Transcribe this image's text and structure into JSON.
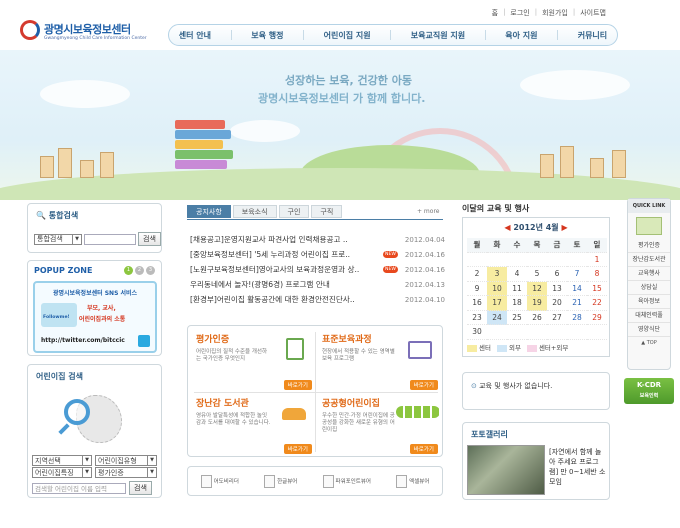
{
  "logo": {
    "ko": "광명시보육정보센터",
    "en": "Gwangmyeong Child Care Information Center"
  },
  "util": [
    "홈",
    "로그인",
    "회원가입",
    "사이트맵"
  ],
  "gnb": [
    "센터 안내",
    "보육 행정",
    "어린이집 지원",
    "보육교직원 지원",
    "육아 지원",
    "커뮤니티"
  ],
  "hero": {
    "line1": "성장하는 보육, 건강한 아동",
    "line2": "광명시보육정보센터 가 함께 합니다."
  },
  "search": {
    "title": "통합검색",
    "select": "통합검색",
    "button": "검색"
  },
  "popup": {
    "title": "POPUP ZONE",
    "pages": [
      "1",
      "2",
      "3"
    ],
    "sns_title": "광명시보육정보센터 SNS 서비스",
    "line1": "부모, 교사,",
    "line2": "어린이집과의 소통",
    "followme": "Followme!",
    "url": "http://twitter.com/bitccic"
  },
  "daycare": {
    "title": "어린이집 검색",
    "sel1": "지역선택",
    "sel2": "어린이집유형",
    "sel3": "어린이집특징",
    "sel4": "평가인증",
    "placeholder": "검색할 어린이집 이름 입력",
    "button": "검색"
  },
  "tabs": [
    "공지사항",
    "보육소식",
    "구인",
    "구직"
  ],
  "more": "+ more",
  "new_label": "NEW",
  "notices": [
    {
      "title": "[채용공고]운영지원교사 파견사업 인력채용공고 ..",
      "date": "2012.04.04",
      "new": false
    },
    {
      "title": "[중앙보육정보센터] '5세 누리과정 어린이집 프로..",
      "date": "2012.04.16",
      "new": true
    },
    {
      "title": "[노원구보육정보센터]영아교사의 보육과정운영과 상..",
      "date": "2012.04.16",
      "new": true
    },
    {
      "title": "우리동네에서 놀자!(광명6경) 프로그램 안내",
      "date": "2012.04.13",
      "new": false
    },
    {
      "title": "[환경부]어린이집 활동공간에 대한 환경안전진단사..",
      "date": "2012.04.10",
      "new": false
    }
  ],
  "services": [
    {
      "title": "평가인증",
      "desc": "어린이집의 질적 수준을 개선하는 국가인증 무엇인지",
      "go": "바로가기"
    },
    {
      "title": "표준보육과정",
      "desc": "현장에서 적용할 수 있는 영역별 보육 프로그램",
      "go": "바로가기"
    },
    {
      "title": "장난감 도서관",
      "desc": "영유아 발달특성에 적합한 놀잇감과 도서를 대여할 수 있습니다.",
      "go": "바로가기"
    },
    {
      "title": "공공형어린이집",
      "desc": "우수한 민간·가정 어린이집에 공공성을 강화한 새로운 유형의 어린이집",
      "go": "바로가기"
    }
  ],
  "links": [
    "어도비리더",
    "한글뷰어",
    "파워포인트뷰어",
    "엑셀뷰어"
  ],
  "calendar": {
    "caption": "이달의 교육 및 행사",
    "title": "2012년 4월",
    "weekdays": [
      "월",
      "화",
      "수",
      "목",
      "금",
      "토",
      "일"
    ],
    "days": [
      "",
      "",
      "",
      "",
      "",
      "",
      "1",
      "2",
      "3",
      "4",
      "5",
      "6",
      "7",
      "8",
      "9",
      "10",
      "11",
      "12",
      "13",
      "14",
      "15",
      "16",
      "17",
      "18",
      "19",
      "20",
      "21",
      "22",
      "23",
      "24",
      "25",
      "26",
      "27",
      "28",
      "29",
      "30",
      "",
      "",
      "",
      "",
      "",
      ""
    ],
    "legend": [
      "센터",
      "외부",
      "센터+외부"
    ],
    "colors": {
      "center": "#f7eca1",
      "outside": "#cfe6f6",
      "both": "#f6d4e6"
    }
  },
  "cal_msg": "교육 및 행사가 없습니다.",
  "photo": {
    "title": "포토갤러리",
    "caption": "[자연에서 함께 놀아 주세요 프로그램] 만 0~1세반 소모임"
  },
  "quick": {
    "title": "QUICK LINK",
    "items": [
      "평가인증",
      "장난감도서관",
      "교육행사",
      "상담실",
      "육아정보",
      "대체인력풀",
      "영양식단"
    ],
    "top": "▲ TOP"
  },
  "kcdr": {
    "line1": "K-CDR",
    "line2": "보육인력"
  }
}
